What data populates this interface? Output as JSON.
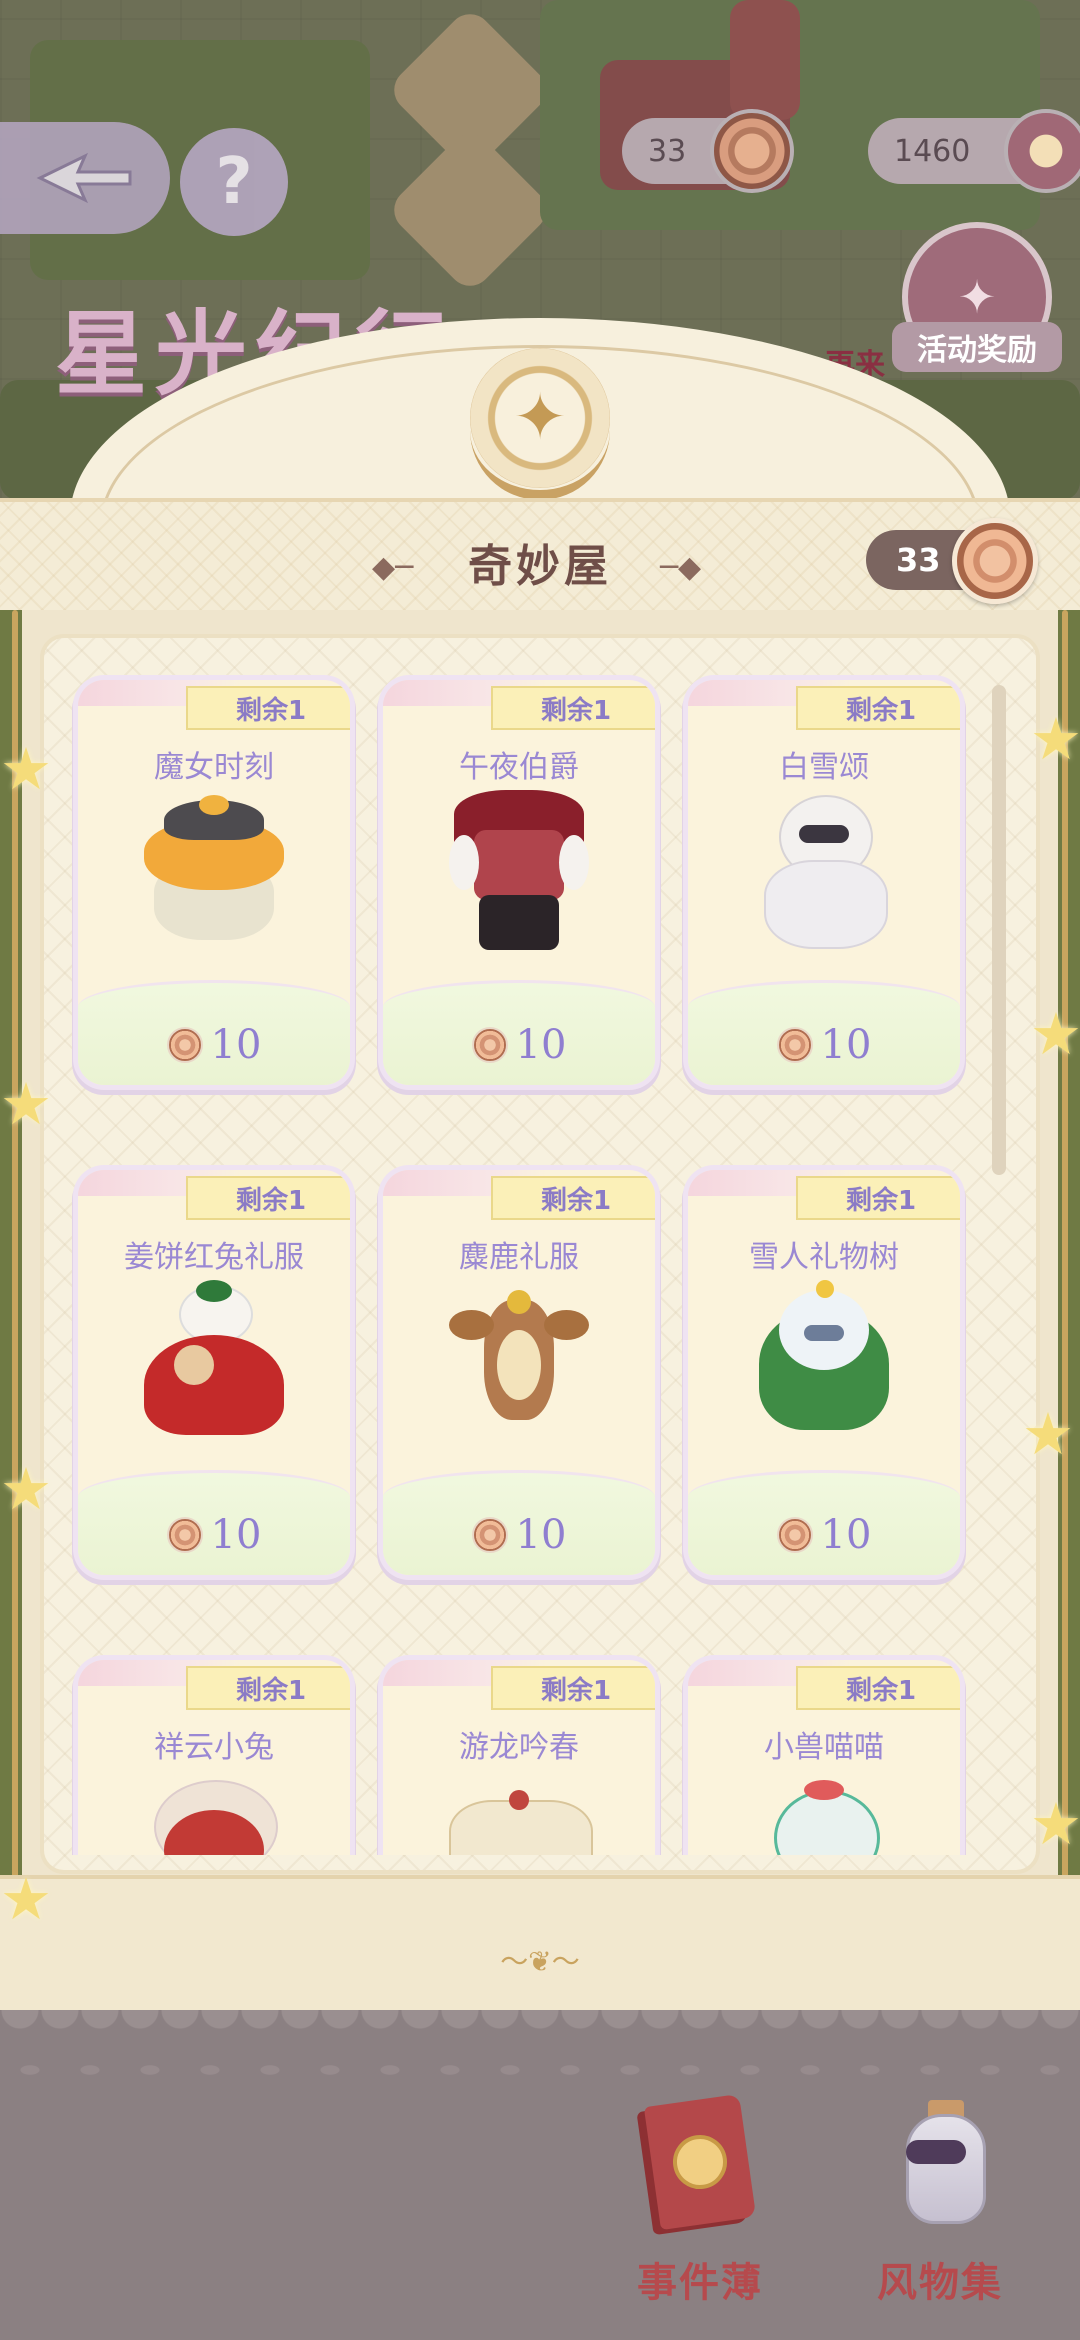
{
  "top_hud": {
    "currency_1_value": "33",
    "currency_2_value": "1460",
    "reward_label": "活动奖励",
    "reward_script": "Reward",
    "again_label": "再来",
    "game_logo": "星光纪行",
    "help_symbol": "?"
  },
  "panel": {
    "title": "奇妙屋",
    "balance": "33"
  },
  "shop": {
    "items": [
      {
        "stock": "剩余1",
        "name": "魔女时刻",
        "price": "10"
      },
      {
        "stock": "剩余1",
        "name": "午夜伯爵",
        "price": "10"
      },
      {
        "stock": "剩余1",
        "name": "白雪颂",
        "price": "10"
      },
      {
        "stock": "剩余1",
        "name": "姜饼红兔礼服",
        "price": "10"
      },
      {
        "stock": "剩余1",
        "name": "麋鹿礼服",
        "price": "10"
      },
      {
        "stock": "剩余1",
        "name": "雪人礼物树",
        "price": "10"
      },
      {
        "stock": "剩余1",
        "name": "祥云小兔",
        "price": ""
      },
      {
        "stock": "剩余1",
        "name": "游龙吟春",
        "price": ""
      },
      {
        "stock": "剩余1",
        "name": "小兽喵喵",
        "price": ""
      }
    ]
  },
  "bottom_nav": {
    "events_label": "事件薄",
    "collection_label": "风物集"
  },
  "colors": {
    "accent_purple": "#9a88d3",
    "title_brown": "#6f4e48",
    "events_red": "#b64a4d"
  },
  "icons": [
    "back-arrow-icon",
    "help-icon",
    "coin-icon",
    "reward-badge-icon",
    "star-emblem-icon",
    "book-icon",
    "bottle-icon",
    "star-decoration-icon"
  ]
}
